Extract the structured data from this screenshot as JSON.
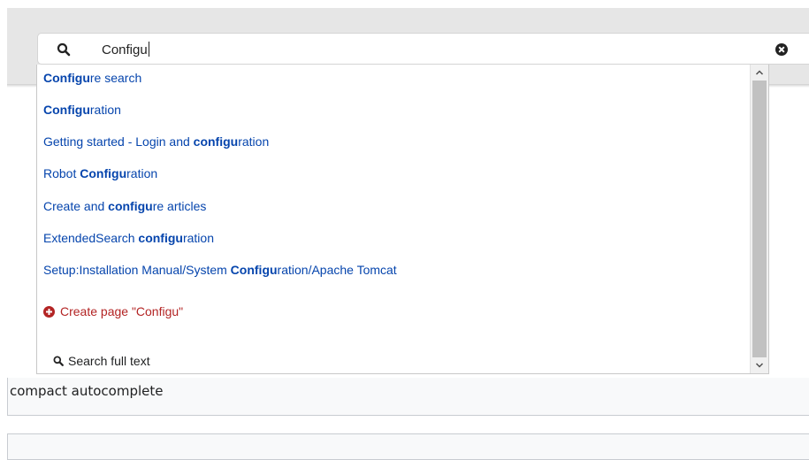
{
  "search": {
    "value": "Configu"
  },
  "suggestions": [
    {
      "highlight": "Configu",
      "pre": "",
      "post": "re search"
    },
    {
      "highlight": "Configu",
      "pre": "",
      "post": "ration"
    },
    {
      "highlight": "configu",
      "pre": "Getting started - Login and ",
      "post": "ration"
    },
    {
      "highlight": "Configu",
      "pre": "Robot ",
      "post": "ration"
    },
    {
      "highlight": "configu",
      "pre": "Create and ",
      "post": "re articles"
    },
    {
      "highlight": "configu",
      "pre": "ExtendedSearch ",
      "post": "ration"
    },
    {
      "highlight": "Configu",
      "pre": "Setup:Installation Manual/System ",
      "post": "ration/Apache Tomcat"
    }
  ],
  "create_page": "Create page \"Configu\"",
  "search_full_text": "Search full text",
  "caption": "compact autocomplete",
  "colors": {
    "link": "#0645ad",
    "create": "#b32424",
    "header_band": "#e6e6e6",
    "scroll_thumb": "#c1c1c1"
  },
  "icons": {
    "search": "magnifier-icon",
    "clear": "clear-circle-x-icon",
    "create": "plus-circle-icon",
    "scroll_up": "chevron-up-icon",
    "scroll_down": "chevron-down-icon"
  }
}
